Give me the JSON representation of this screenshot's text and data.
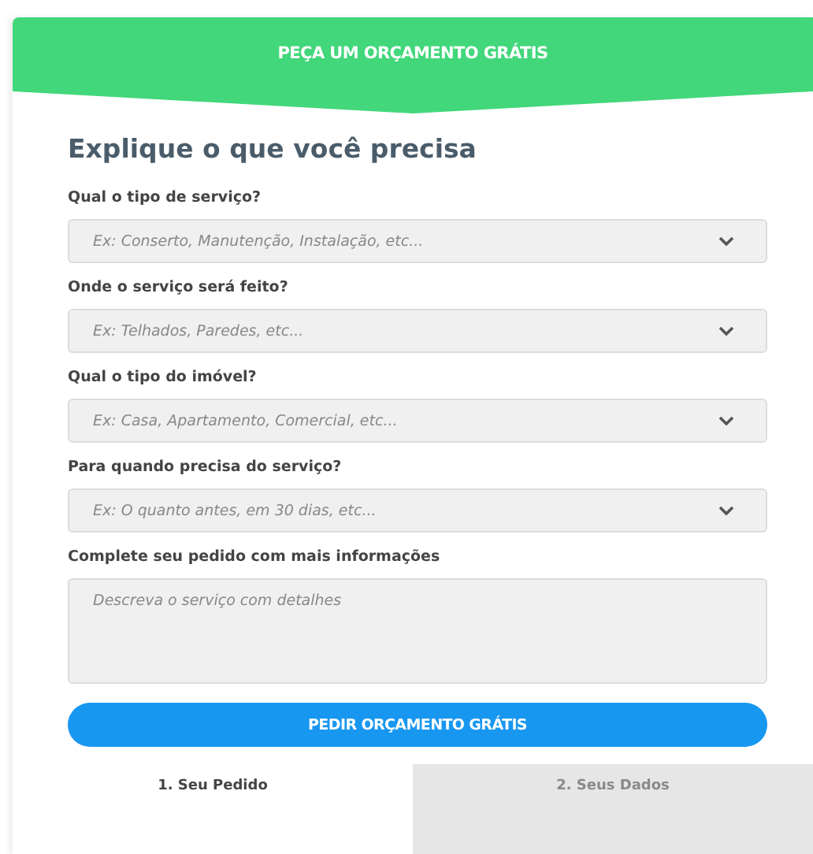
{
  "header": {
    "title": "PEÇA UM ORÇAMENTO GRÁTIS"
  },
  "heading": "Explique o que você precisa",
  "fields": [
    {
      "kind": "select",
      "label": "Qual o tipo de serviço?",
      "placeholder": "Ex: Conserto, Manutenção, Instalação, etc..."
    },
    {
      "kind": "select",
      "label": "Onde o serviço será feito?",
      "placeholder": "Ex: Telhados, Paredes, etc..."
    },
    {
      "kind": "select",
      "label": "Qual o tipo do imóvel?",
      "placeholder": "Ex: Casa, Apartamento, Comercial, etc..."
    },
    {
      "kind": "select",
      "label": "Para quando precisa do serviço?",
      "placeholder": "Ex: O quanto antes, em 30 dias, etc..."
    },
    {
      "kind": "textarea",
      "label": "Complete seu pedido com mais informações",
      "placeholder": "Descreva o serviço com detalhes"
    }
  ],
  "submit": "PEDIR ORÇAMENTO GRÁTIS",
  "tabs": [
    {
      "label": "1. Seu Pedido",
      "selected": true
    },
    {
      "label": "2. Seus Dados",
      "selected": false
    }
  ]
}
